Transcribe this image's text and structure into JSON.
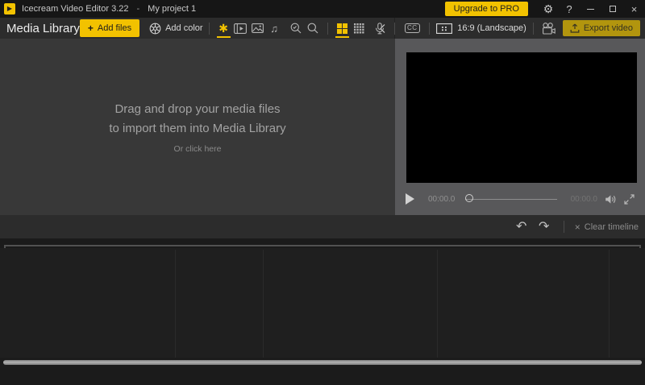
{
  "titlebar": {
    "app_name": "Icecream Video Editor 3.22",
    "dash": "-",
    "project": "My project 1",
    "upgrade": "Upgrade to PRO",
    "gear": "⚙",
    "help": "?",
    "close": "×"
  },
  "library": {
    "title": "Media Library",
    "plus": "+",
    "add_files": "Add files",
    "add_color": "Add color",
    "filter_all_glyph": "✱",
    "drop_line1": "Drag and drop your media files",
    "drop_line2": "to import them into Media Library",
    "drop_hint": "Or click here"
  },
  "player": {
    "cc_label": "CC",
    "aspect_ratio": "16:9 (Landscape)",
    "export": "Export video",
    "time_current": "00:00.0",
    "time_total": "00:00.0"
  },
  "history": {
    "undo_glyph": "↶",
    "redo_glyph": "↷",
    "clear_x": "×",
    "clear_label": "Clear timeline"
  },
  "colors": {
    "accent_yellow": "#f2c200",
    "export_dimmed_yellow": "#b2950e",
    "titlebar_bg": "#161616",
    "toolbar_bg": "#2c2c2c",
    "library_bg": "#383838",
    "player_bg": "#58585a",
    "timeline_bg": "#1b1b1b"
  }
}
